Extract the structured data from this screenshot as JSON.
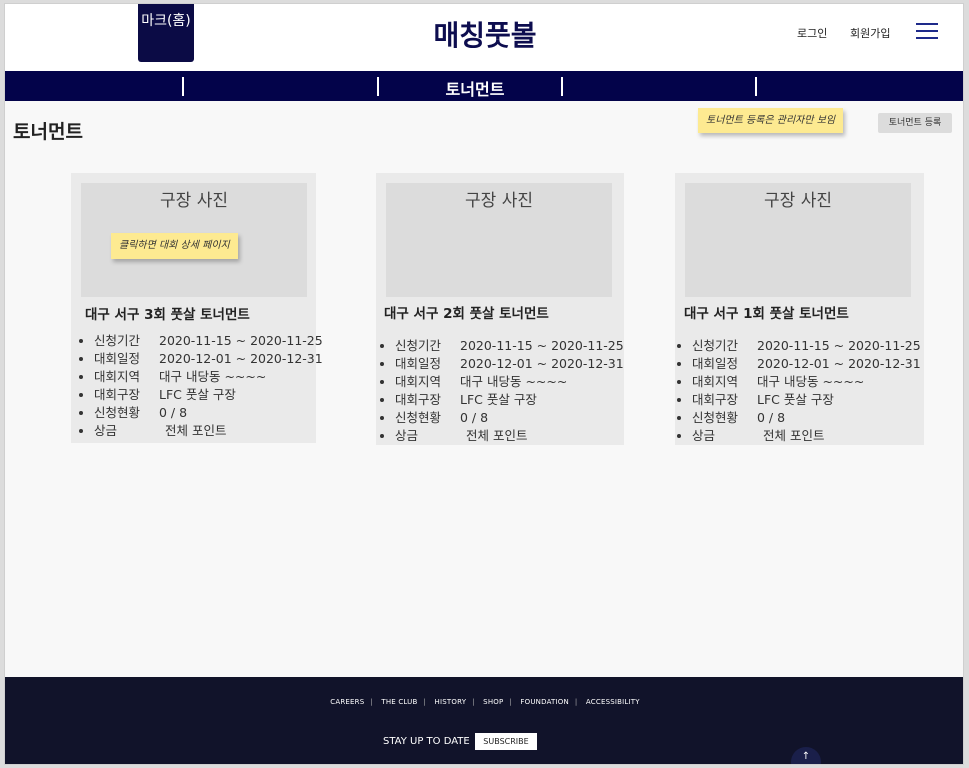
{
  "header": {
    "logo_label": "마크(홈)",
    "site_title": "매칭풋볼",
    "login": "로그인",
    "signup": "회원가입"
  },
  "nav": {
    "active_tab": "토너먼트"
  },
  "page": {
    "title": "토너먼트",
    "admin_note": "토너먼트 등록은 관리자만 보임",
    "register_button": "토너먼트 등록",
    "detail_note": "클릭하면 대회 상세 페이지"
  },
  "cards": [
    {
      "photo_label": "구장 사진",
      "title": "대구 서구 3회 풋살 토너먼트",
      "rows": [
        {
          "key": "신청기간",
          "value": "2020-11-15 ~ 2020-11-25"
        },
        {
          "key": "대회일정",
          "value": "2020-12-01 ~ 2020-12-31"
        },
        {
          "key": "대회지역",
          "value": "대구 내당동 ~~~~"
        },
        {
          "key": "대회구장",
          "value": "LFC 풋살 구장"
        },
        {
          "key": "신청현황",
          "value": "0 / 8"
        },
        {
          "key": "상금",
          "value": "전체 포인트"
        }
      ]
    },
    {
      "photo_label": "구장 사진",
      "title": "대구 서구 2회 풋살 토너먼트",
      "rows": [
        {
          "key": "신청기간",
          "value": "2020-11-15 ~ 2020-11-25"
        },
        {
          "key": "대회일정",
          "value": "2020-12-01 ~ 2020-12-31"
        },
        {
          "key": "대회지역",
          "value": "대구 내당동 ~~~~"
        },
        {
          "key": "대회구장",
          "value": "LFC 풋살 구장"
        },
        {
          "key": "신청현황",
          "value": "0 / 8"
        },
        {
          "key": "상금",
          "value": "전체 포인트"
        }
      ]
    },
    {
      "photo_label": "구장 사진",
      "title": "대구 서구 1회 풋살 토너먼트",
      "rows": [
        {
          "key": "신청기간",
          "value": "2020-11-15 ~ 2020-11-25"
        },
        {
          "key": "대회일정",
          "value": "2020-12-01 ~ 2020-12-31"
        },
        {
          "key": "대회지역",
          "value": "대구 내당동 ~~~~"
        },
        {
          "key": "대회구장",
          "value": "LFC 풋살 구장"
        },
        {
          "key": "신청현황",
          "value": "0 / 8"
        },
        {
          "key": "상금",
          "value": "전체 포인트"
        }
      ]
    }
  ],
  "footer": {
    "links": [
      "CAREERS",
      "THE CLUB",
      "HISTORY",
      "SHOP",
      "FOUNDATION",
      "ACCESSIBILITY"
    ],
    "stay_label": "STAY UP TO DATE",
    "subscribe": "SUBSCRIBE",
    "top_arrow": "↑"
  },
  "colors": {
    "navy": "#03034a",
    "footer": "#11132a",
    "note": "#fdea91"
  }
}
